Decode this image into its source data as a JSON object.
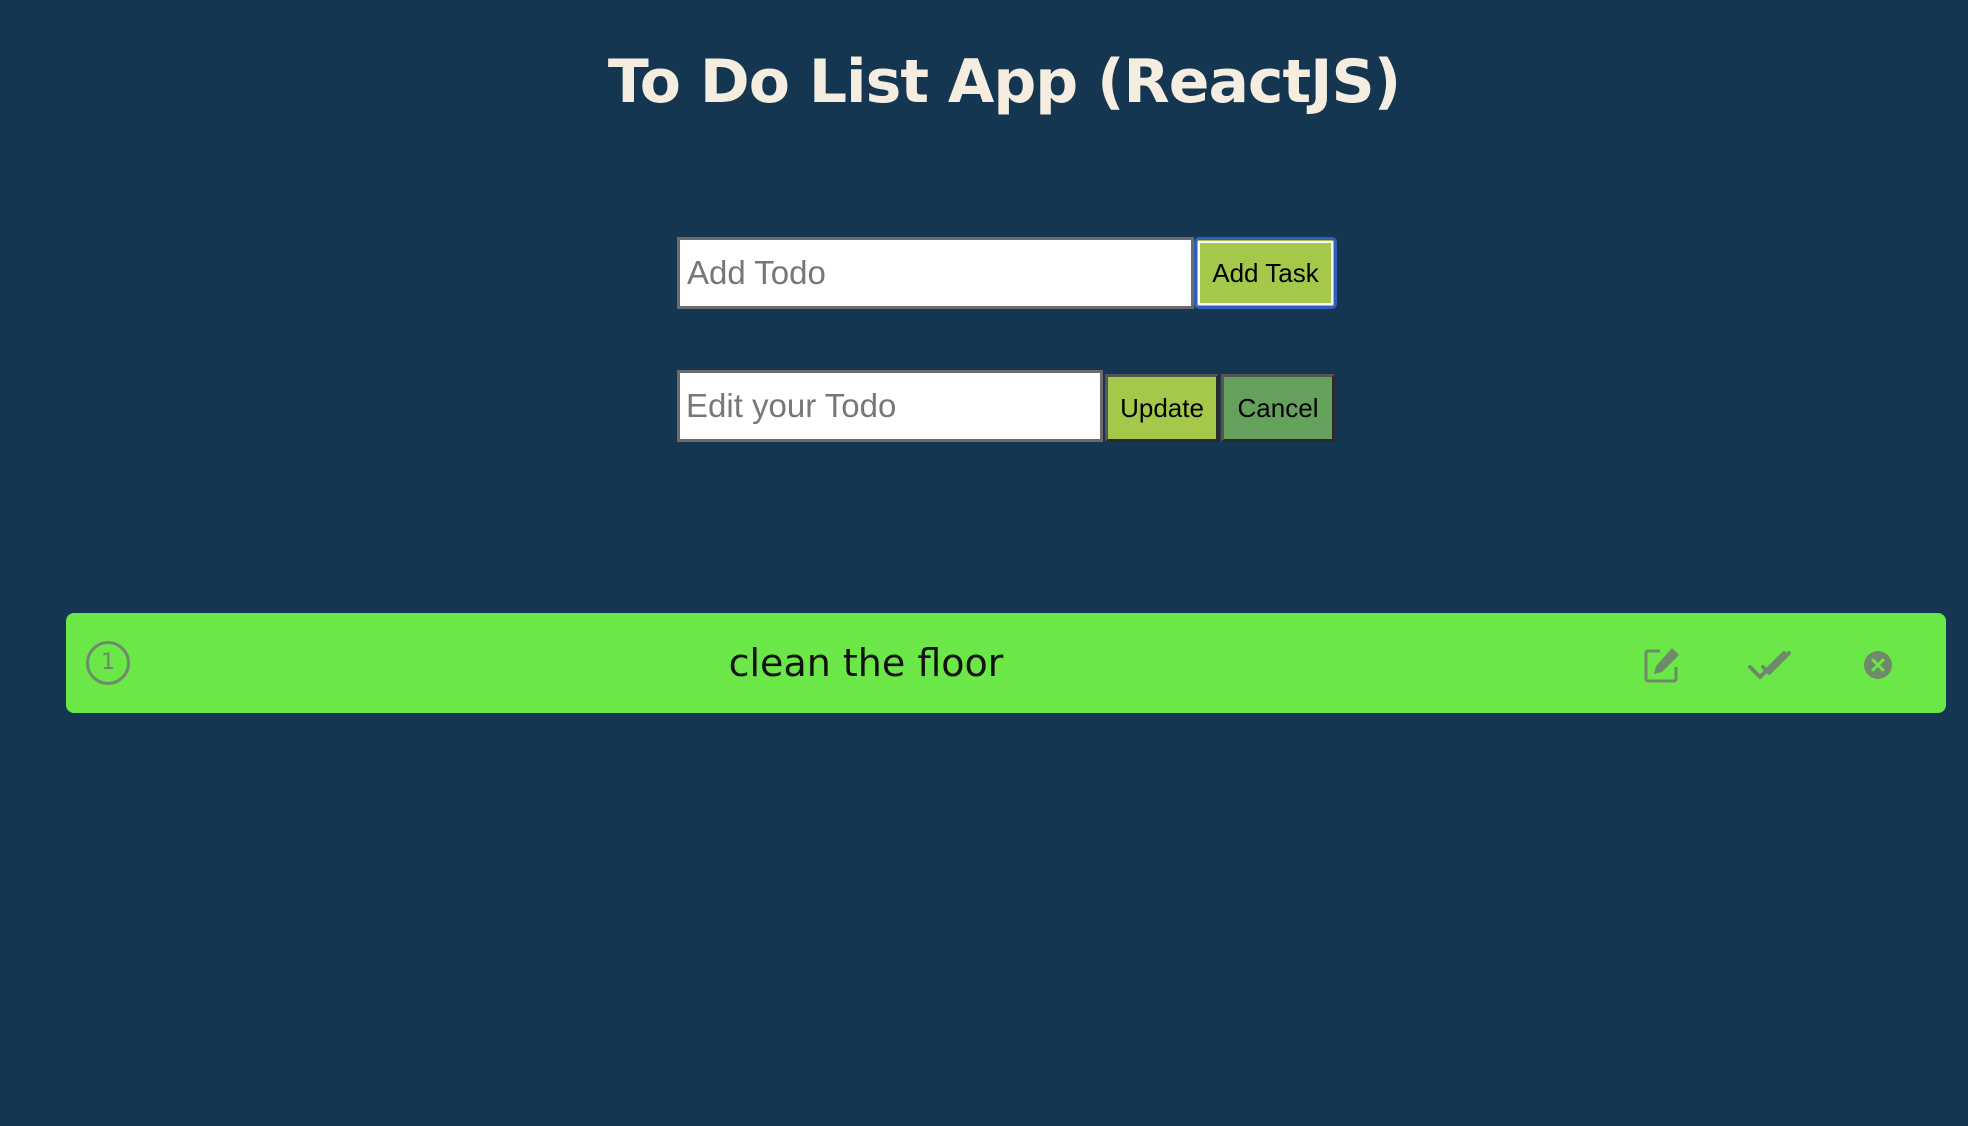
{
  "header": {
    "title": "To Do List App (ReactJS)"
  },
  "add_form": {
    "input_placeholder": "Add Todo",
    "input_value": "",
    "button_label": "Add Task"
  },
  "edit_form": {
    "input_placeholder": "Edit your Todo",
    "input_value": "",
    "update_label": "Update",
    "cancel_label": "Cancel"
  },
  "todos": [
    {
      "number": "1",
      "text": "clean the floor",
      "icons": [
        "pen-to-square-icon",
        "check-double-icon",
        "circle-xmark-icon"
      ]
    }
  ],
  "colors": {
    "background": "#143651",
    "title": "#f4ede0",
    "add_button": "#a4c84a",
    "update_button": "#a4c84a",
    "cancel_button": "#65a15c",
    "todo_item": "#6be848",
    "icon": "#6f8a6a"
  }
}
